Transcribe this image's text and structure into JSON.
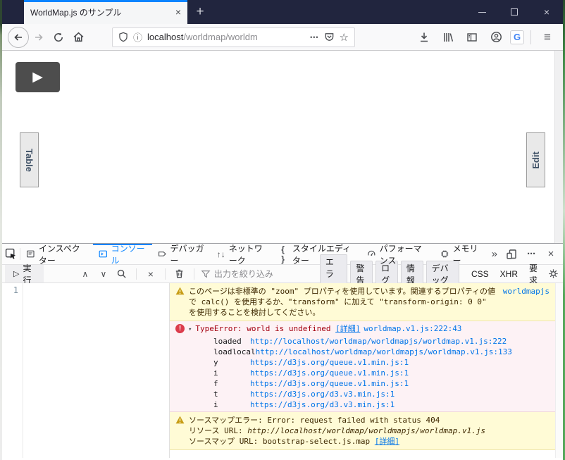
{
  "browser": {
    "tab": {
      "title": "WorldMap.js のサンプル",
      "close_glyph": "×"
    },
    "new_tab_glyph": "+",
    "window_controls": {
      "close_glyph": "×"
    },
    "urlbar": {
      "host": "localhost",
      "path": "/worldmap/worldm",
      "dots_glyph": "•••",
      "info_glyph": "ⓘ",
      "star_glyph": "☆"
    },
    "g_extension_label": "G",
    "menu_glyph": "≡"
  },
  "page": {
    "play_glyph": "▶",
    "table_button_label": "Table",
    "edit_button_label": "Edit"
  },
  "devtools": {
    "tabs": {
      "inspector": "インスペクター",
      "console": "コンソール",
      "debugger": "デバッガー",
      "network": "ネットワーク",
      "style_editor": "スタイルエディター",
      "performance": "パフォーマンス",
      "memory": "メモリー",
      "overflow_glyph": "»"
    },
    "tab_icon_glyphs": {
      "network": "↑↓",
      "style_editor": "{ }",
      "meatball": "···",
      "close": "×"
    },
    "console_toolbar": {
      "run_glyph": "▷",
      "run_label": "実行",
      "prev_glyph": "∧",
      "next_glyph": "∨",
      "close_glyph": "×",
      "filter_placeholder": "出力を絞り込み",
      "filters_on": [
        "エラー",
        "警告",
        "ログ",
        "情報",
        "デバッグ"
      ],
      "filters_off": [
        "CSS",
        "XHR",
        "要求"
      ]
    },
    "editor": {
      "line_number": "1"
    },
    "console": {
      "zoom_warning": {
        "text": "このページは非標準の \"zoom\" プロパティを使用しています。関連するプロパティの値で calc() を使用するか、\"transform\" に加えて \"transform-origin: 0 0\" を使用することを検討してください。",
        "source": "worldmapjs"
      },
      "type_error": {
        "twisty_glyph": "▾",
        "badge_glyph": "!",
        "message": "TypeError: world is undefined",
        "details_link": "[詳細]",
        "source": "worldmap.v1.js:222:43",
        "stack": [
          {
            "fn": "loaded",
            "url": "http://localhost/worldmap/worldmapjs/worldmap.v1.js:222"
          },
          {
            "fn": "loadlocal",
            "url": "http://localhost/worldmap/worldmapjs/worldmap.v1.js:133"
          },
          {
            "fn": "y",
            "url": "https://d3js.org/queue.v1.min.js:1"
          },
          {
            "fn": "i",
            "url": "https://d3js.org/queue.v1.min.js:1"
          },
          {
            "fn": "f",
            "url": "https://d3js.org/queue.v1.min.js:1"
          },
          {
            "fn": "t",
            "url": "https://d3js.org/d3.v3.min.js:1"
          },
          {
            "fn": "i",
            "url": "https://d3js.org/d3.v3.min.js:1"
          }
        ]
      },
      "sourcemap_warning": {
        "line1": "ソースマップエラー: Error: request failed with status 404",
        "resource_label": "リソース URL:",
        "resource_url": "http://localhost/worldmap/worldmapjs/worldmap.v1.js",
        "map_label": "ソースマップ URL:",
        "map_url": "bootstrap-select.js.map",
        "details_link": "[詳細]"
      }
    }
  },
  "colors": {
    "accent_blue": "#0a84ff",
    "link_blue": "#0074e8",
    "warning_bg": "#fffbd6",
    "error_bg": "#fdf2f5",
    "titlebar": "#21253e"
  }
}
